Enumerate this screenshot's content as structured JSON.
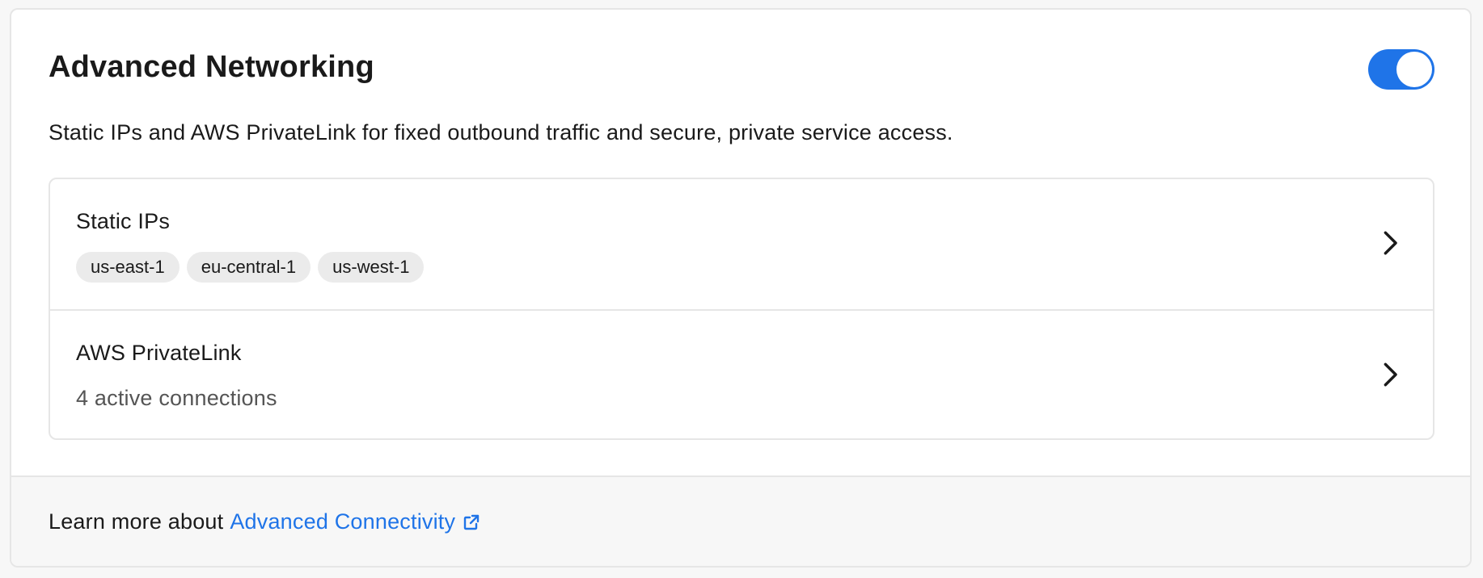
{
  "section": {
    "title": "Advanced Networking",
    "description": "Static IPs and AWS PrivateLink for fixed outbound traffic and secure, private service access.",
    "enabled": true
  },
  "items": [
    {
      "label": "Static IPs",
      "tags": [
        "us-east-1",
        "eu-central-1",
        "us-west-1"
      ],
      "icon": "chevron-right-icon"
    },
    {
      "label": "AWS PrivateLink",
      "subtitle": "4 active connections",
      "icon": "chevron-right-icon"
    }
  ],
  "footer": {
    "prefix": "Learn more about",
    "link_label": "Advanced Connectivity",
    "link_icon": "external-link-icon"
  },
  "colors": {
    "accent": "#1f74e8",
    "tag_bg": "#ebebeb",
    "border": "#e6e6e6",
    "footer_bg": "#f7f7f7"
  }
}
